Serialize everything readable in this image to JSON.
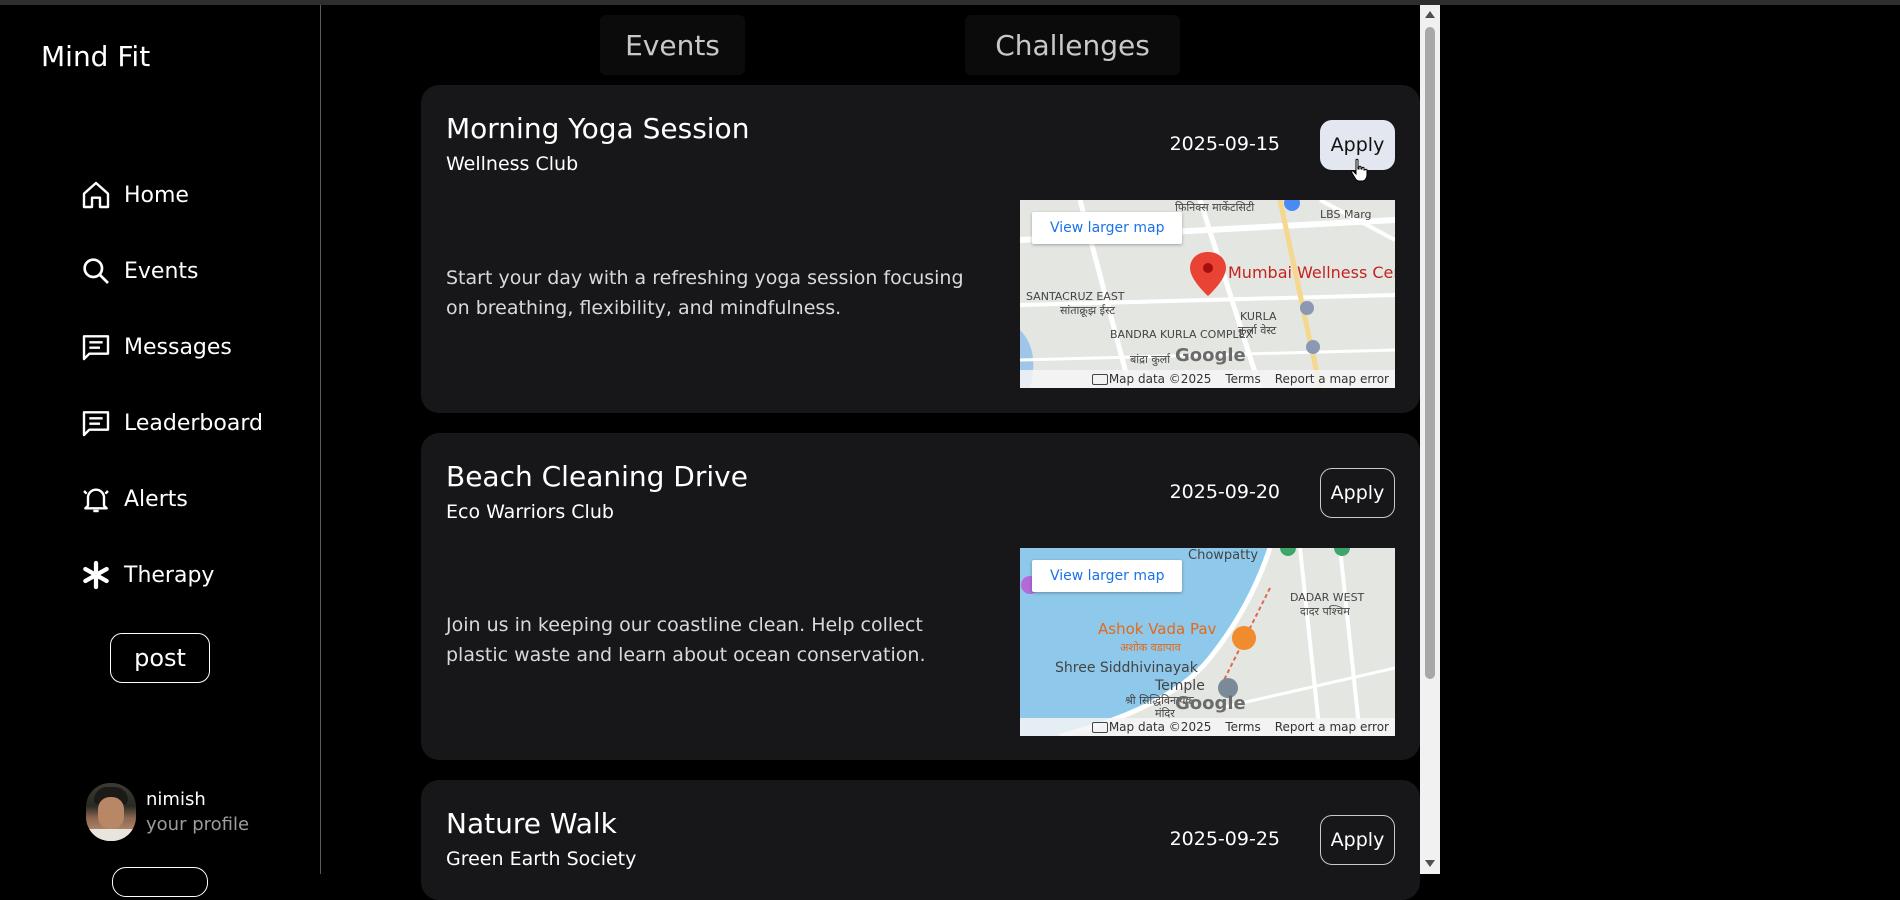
{
  "app": {
    "title": "Mind Fit"
  },
  "sidebar": {
    "items": [
      {
        "label": "Home",
        "icon": "home-icon"
      },
      {
        "label": "Events",
        "icon": "search-icon"
      },
      {
        "label": "Messages",
        "icon": "message-icon"
      },
      {
        "label": "Leaderboard",
        "icon": "message-icon"
      },
      {
        "label": "Alerts",
        "icon": "bell-icon"
      },
      {
        "label": "Therapy",
        "icon": "asterisk-icon"
      }
    ],
    "post_label": "post",
    "profile": {
      "name": "nimish",
      "subtitle": "your profile"
    }
  },
  "tabs": [
    {
      "label": "Events"
    },
    {
      "label": "Challenges"
    }
  ],
  "events": [
    {
      "title": "Morning Yoga Session",
      "club": "Wellness Club",
      "date": "2025-09-15",
      "apply_label": "Apply",
      "description": "Start your day with a refreshing yoga session focusing on breathing, flexibility, and mindfulness.",
      "map": {
        "link": "View larger map",
        "poi": "Mumbai Wellness Cen",
        "labels": [
          "SANTACRUZ EAST",
          "सांताक्रूझ ईस्ट",
          "BANDRA KURLA COMPLEX",
          "बांद्रा कुर्ला",
          "KURLA",
          "कुर्ला वेस्ट",
          "LBS Marg",
          "फिनिक्स मार्केटसिटी"
        ],
        "footer": {
          "data": "Map data ©2025",
          "terms": "Terms",
          "report": "Report a map error"
        },
        "logo": "Google"
      }
    },
    {
      "title": "Beach Cleaning Drive",
      "club": "Eco Warriors Club",
      "date": "2025-09-20",
      "apply_label": "Apply",
      "description": "Join us in keeping our coastline clean. Help collect plastic waste and learn about ocean conservation.",
      "map": {
        "link": "View larger map",
        "poi": "Ashok Vada Pav",
        "labels": [
          "Chowpatty",
          "DADAR WEST",
          "दादर पश्चिम",
          "अशोक वडापाव",
          "Shree Siddhivinayak",
          "Temple",
          "श्री सिद्धिविनायक",
          "मंदिर"
        ],
        "footer": {
          "data": "Map data ©2025",
          "terms": "Terms",
          "report": "Report a map error"
        },
        "logo": "Google"
      }
    },
    {
      "title": "Nature Walk",
      "club": "Green Earth Society",
      "date": "2025-09-25",
      "apply_label": "Apply"
    }
  ]
}
